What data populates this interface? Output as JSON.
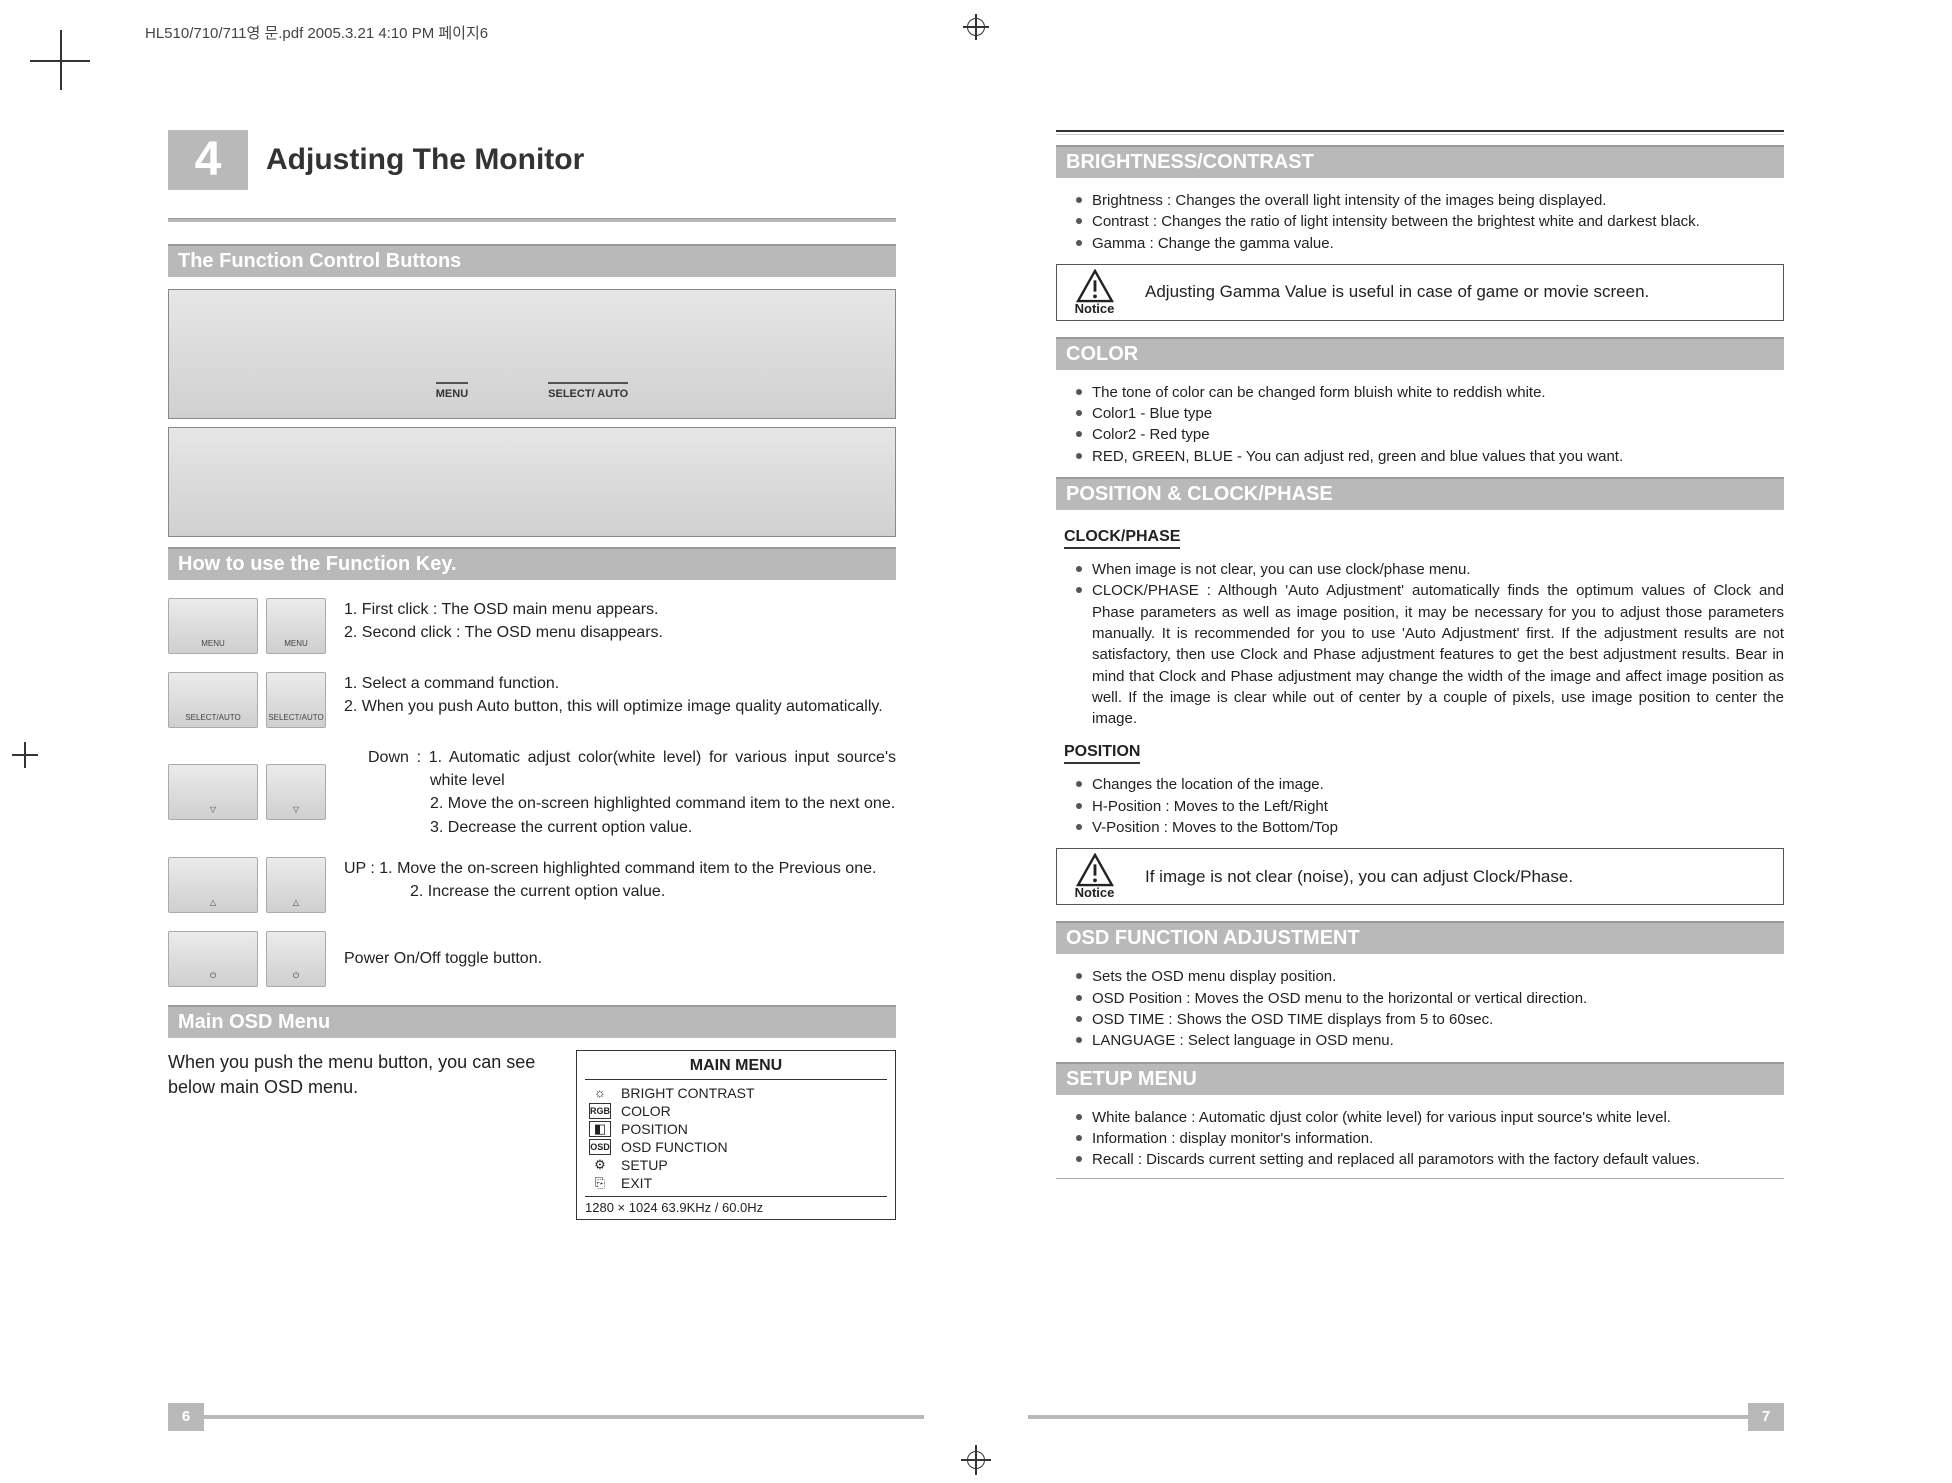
{
  "header": "HL510/710/711영 문.pdf  2005.3.21  4:10 PM  페이지6",
  "chapter": {
    "number": "4",
    "title": "Adjusting The Monitor"
  },
  "left": {
    "sec1": "The Function Control Buttons",
    "photo_labels": {
      "a": "MENU",
      "b": "SELECT/ AUTO"
    },
    "sec2": "How to use the Function Key.",
    "rows": {
      "menu1": "1. First click : The OSD main menu appears.",
      "menu2": "2. Second click : The OSD menu disappears.",
      "sel1": "1. Select a command function.",
      "sel2": "2. When you push Auto button, this will optimize image quality automatically.",
      "down_pre": "Down : 1. Automatic adjust color(white level) for various input source's white level",
      "down2": "2. Move the on-screen highlighted command item to the next one.",
      "down3": "3. Decrease the current option value.",
      "up_pre": "UP : 1. Move the on-screen highlighted command item to the Previous one.",
      "up2": "2. Increase the current option value.",
      "power": "Power On/Off toggle button."
    },
    "sec3": "Main OSD Menu",
    "osd_intro": "When you push the menu button, you can see below main OSD menu.",
    "osd": {
      "title": "MAIN MENU",
      "items": [
        "BRIGHT  CONTRAST",
        "COLOR",
        "POSITION",
        "OSD FUNCTION",
        "SETUP",
        "EXIT"
      ],
      "icons": [
        "☼",
        "RGB",
        "◧",
        "OSD",
        "⚙",
        "⎘"
      ],
      "footer": "1280 × 1024     63.9KHz  /  60.0Hz"
    },
    "page_num": "6"
  },
  "right": {
    "bc": {
      "title": "BRIGHTNESS/CONTRAST",
      "items": [
        "Brightness : Changes the overall light intensity of the images being displayed.",
        "Contrast : Changes the ratio of light intensity between the brightest white and darkest black.",
        "Gamma : Change the gamma value."
      ],
      "notice": "Adjusting Gamma Value is useful in case of game or movie screen."
    },
    "color": {
      "title": "COLOR",
      "items": [
        "The tone of color can be changed form bluish white to reddish white.",
        "Color1 - Blue type",
        "Color2 - Red type",
        "RED, GREEN, BLUE - You can adjust red, green and blue values that you want."
      ]
    },
    "pos": {
      "title": "POSITION & CLOCK/PHASE",
      "sub1": "CLOCK/PHASE",
      "cp_items": [
        "When image is not clear, you can use clock/phase menu.",
        "CLOCK/PHASE : Although 'Auto Adjustment' automatically finds the optimum values of Clock and Phase parameters as well as image position, it may be necessary for you to adjust those parameters manually. It is recommended for you to use 'Auto Adjustment' first. If the adjustment results are not satisfactory, then use Clock and Phase adjustment features to get the best adjustment results. Bear in mind that Clock and Phase adjustment may change the width of the image and affect image position as well. If the image is clear while out of center by a couple of pixels, use image position to center the image."
      ],
      "sub2": "POSITION",
      "p_items": [
        "Changes the location of the image.",
        "H-Position : Moves to the Left/Right",
        "V-Position : Moves to the Bottom/Top"
      ],
      "notice": "If image is not clear (noise), you can adjust Clock/Phase."
    },
    "osdfn": {
      "title": "OSD FUNCTION ADJUSTMENT",
      "items": [
        "Sets the OSD menu display position.",
        "OSD Position : Moves the OSD menu to the horizontal or vertical direction.",
        "OSD TIME : Shows the OSD TIME displays from 5 to 60sec.",
        "LANGUAGE : Select language in OSD menu."
      ]
    },
    "setup": {
      "title": "SETUP MENU",
      "items": [
        "White balance : Automatic djust color (white level) for various input source's white level.",
        "Information : display monitor's information.",
        "Recall : Discards current setting and replaced all paramotors with the factory default values."
      ]
    },
    "notice_label": "Notice",
    "page_num": "7"
  }
}
